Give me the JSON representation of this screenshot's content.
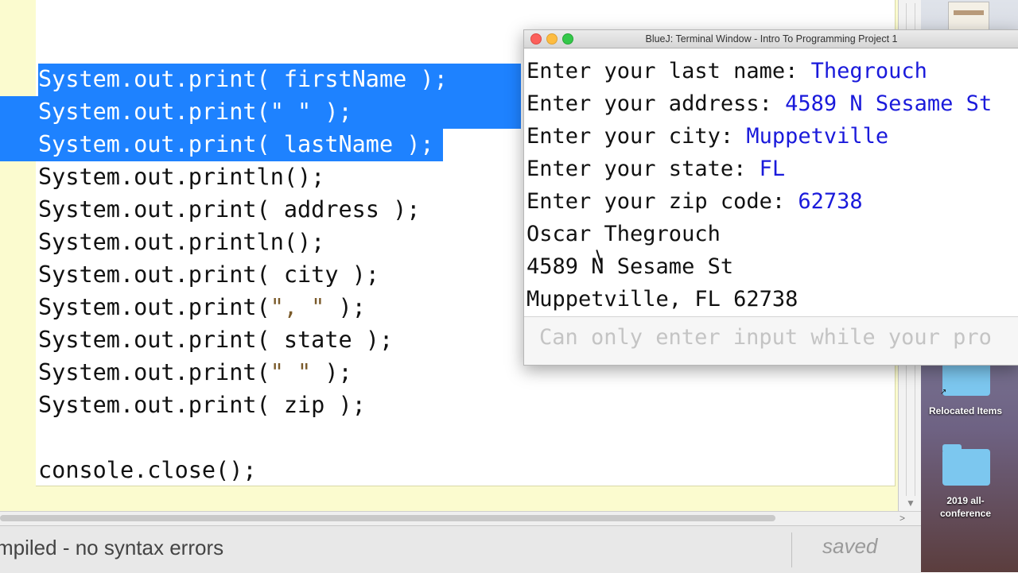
{
  "editor": {
    "lines": [
      {
        "parts": [
          "System.out.print( firstName );"
        ],
        "selected": true
      },
      {
        "parts": [
          "System.out.print(",
          "\" \"",
          " );"
        ],
        "selected": true
      },
      {
        "parts": [
          "System.out.print( lastName );"
        ],
        "selected": true
      },
      {
        "parts": [
          "System.out.println();"
        ],
        "selected": false
      },
      {
        "parts": [
          "System.out.print( address );"
        ],
        "selected": false
      },
      {
        "parts": [
          "System.out.println();"
        ],
        "selected": false
      },
      {
        "parts": [
          "System.out.print( city );"
        ],
        "selected": false
      },
      {
        "parts": [
          "System.out.print(",
          "\", \"",
          " );"
        ],
        "selected": false
      },
      {
        "parts": [
          "System.out.print( state );"
        ],
        "selected": false
      },
      {
        "parts": [
          "System.out.print(",
          "\" \"",
          " );"
        ],
        "selected": false
      },
      {
        "parts": [
          "System.out.print( zip );"
        ],
        "selected": false
      },
      {
        "parts": [
          ""
        ],
        "selected": false
      },
      {
        "parts": [
          "console.close();"
        ],
        "selected": false
      }
    ],
    "status_message": "mpiled - no syntax errors",
    "status_saved": "saved",
    "selection_color": "#1e82ff"
  },
  "terminal": {
    "title": "BlueJ: Terminal Window - Intro To Programming Project 1",
    "lines": [
      {
        "prompt": "Enter your last name: ",
        "input": "Thegrouch"
      },
      {
        "prompt": "Enter your address: ",
        "input": "4589 N Sesame St"
      },
      {
        "prompt": "Enter your city: ",
        "input": "Muppetville"
      },
      {
        "prompt": "Enter your state: ",
        "input": "FL"
      },
      {
        "prompt": "Enter your zip code: ",
        "input": "62738"
      },
      {
        "prompt": "Oscar Thegrouch",
        "input": ""
      },
      {
        "prompt": "4589 N Sesame St",
        "input": ""
      },
      {
        "prompt": "Muppetville, FL 62738",
        "input": ""
      }
    ],
    "input_placeholder": "Can only enter input while your pro",
    "input_color": "#1a1adb"
  },
  "desktop": {
    "items": [
      {
        "label": "Relocated Items",
        "icon": "folder-alias-icon"
      },
      {
        "label": "2019 all-\nconference",
        "icon": "folder-icon"
      }
    ]
  }
}
